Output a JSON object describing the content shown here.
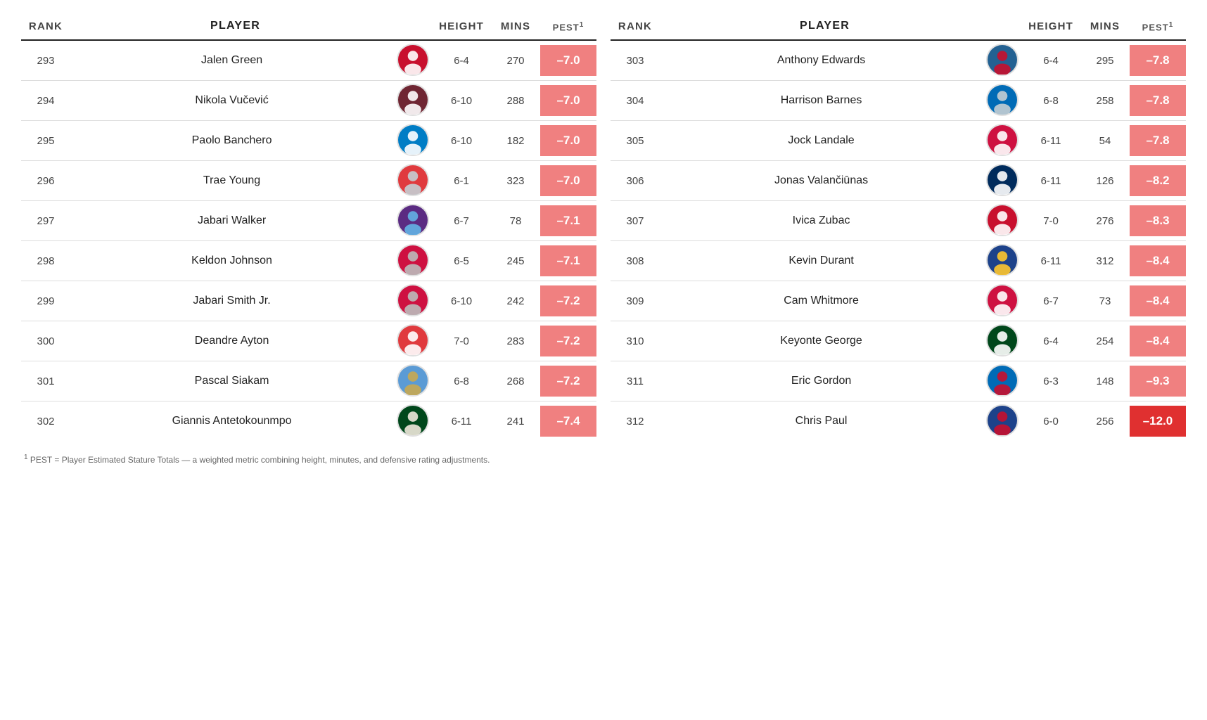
{
  "header": {
    "cols_left": [
      "RANK",
      "PLAYER",
      "",
      "HEIGHT",
      "MINS",
      "PEST¹"
    ],
    "cols_right": [
      "RANK",
      "PLAYER",
      "",
      "HEIGHT",
      "MINS",
      "PEST¹"
    ]
  },
  "left_rows": [
    {
      "rank": "293",
      "player": "Jalen Green",
      "height": "6-4",
      "mins": "270",
      "pest": "–7.0",
      "dark": false
    },
    {
      "rank": "294",
      "player": "Nikola Vučević",
      "height": "6-10",
      "mins": "288",
      "pest": "–7.0",
      "dark": false
    },
    {
      "rank": "295",
      "player": "Paolo Banchero",
      "height": "6-10",
      "mins": "182",
      "pest": "–7.0",
      "dark": false
    },
    {
      "rank": "296",
      "player": "Trae Young",
      "height": "6-1",
      "mins": "323",
      "pest": "–7.0",
      "dark": false
    },
    {
      "rank": "297",
      "player": "Jabari Walker",
      "height": "6-7",
      "mins": "78",
      "pest": "–7.1",
      "dark": false
    },
    {
      "rank": "298",
      "player": "Keldon Johnson",
      "height": "6-5",
      "mins": "245",
      "pest": "–7.1",
      "dark": false
    },
    {
      "rank": "299",
      "player": "Jabari Smith Jr.",
      "height": "6-10",
      "mins": "242",
      "pest": "–7.2",
      "dark": false
    },
    {
      "rank": "300",
      "player": "Deandre Ayton",
      "height": "7-0",
      "mins": "283",
      "pest": "–7.2",
      "dark": false
    },
    {
      "rank": "301",
      "player": "Pascal Siakam",
      "height": "6-8",
      "mins": "268",
      "pest": "–7.2",
      "dark": false
    },
    {
      "rank": "302",
      "player": "Giannis Antetokounmpo",
      "height": "6-11",
      "mins": "241",
      "pest": "–7.4",
      "dark": false
    }
  ],
  "right_rows": [
    {
      "rank": "303",
      "player": "Anthony Edwards",
      "height": "6-4",
      "mins": "295",
      "pest": "–7.8",
      "dark": false
    },
    {
      "rank": "304",
      "player": "Harrison Barnes",
      "height": "6-8",
      "mins": "258",
      "pest": "–7.8",
      "dark": false
    },
    {
      "rank": "305",
      "player": "Jock Landale",
      "height": "6-11",
      "mins": "54",
      "pest": "–7.8",
      "dark": false
    },
    {
      "rank": "306",
      "player": "Jonas Valančiūnas",
      "height": "6-11",
      "mins": "126",
      "pest": "–8.2",
      "dark": false
    },
    {
      "rank": "307",
      "player": "Ivica Zubac",
      "height": "7-0",
      "mins": "276",
      "pest": "–8.3",
      "dark": false
    },
    {
      "rank": "308",
      "player": "Kevin Durant",
      "height": "6-11",
      "mins": "312",
      "pest": "–8.4",
      "dark": false
    },
    {
      "rank": "309",
      "player": "Cam Whitmore",
      "height": "6-7",
      "mins": "73",
      "pest": "–8.4",
      "dark": false
    },
    {
      "rank": "310",
      "player": "Keyonte George",
      "height": "6-4",
      "mins": "254",
      "pest": "–8.4",
      "dark": false
    },
    {
      "rank": "311",
      "player": "Eric Gordon",
      "height": "6-3",
      "mins": "148",
      "pest": "–9.3",
      "dark": false
    },
    {
      "rank": "312",
      "player": "Chris Paul",
      "height": "6-0",
      "mins": "256",
      "pest": "–12.0",
      "dark": true
    }
  ],
  "footnote": "¹ PEST = ..."
}
